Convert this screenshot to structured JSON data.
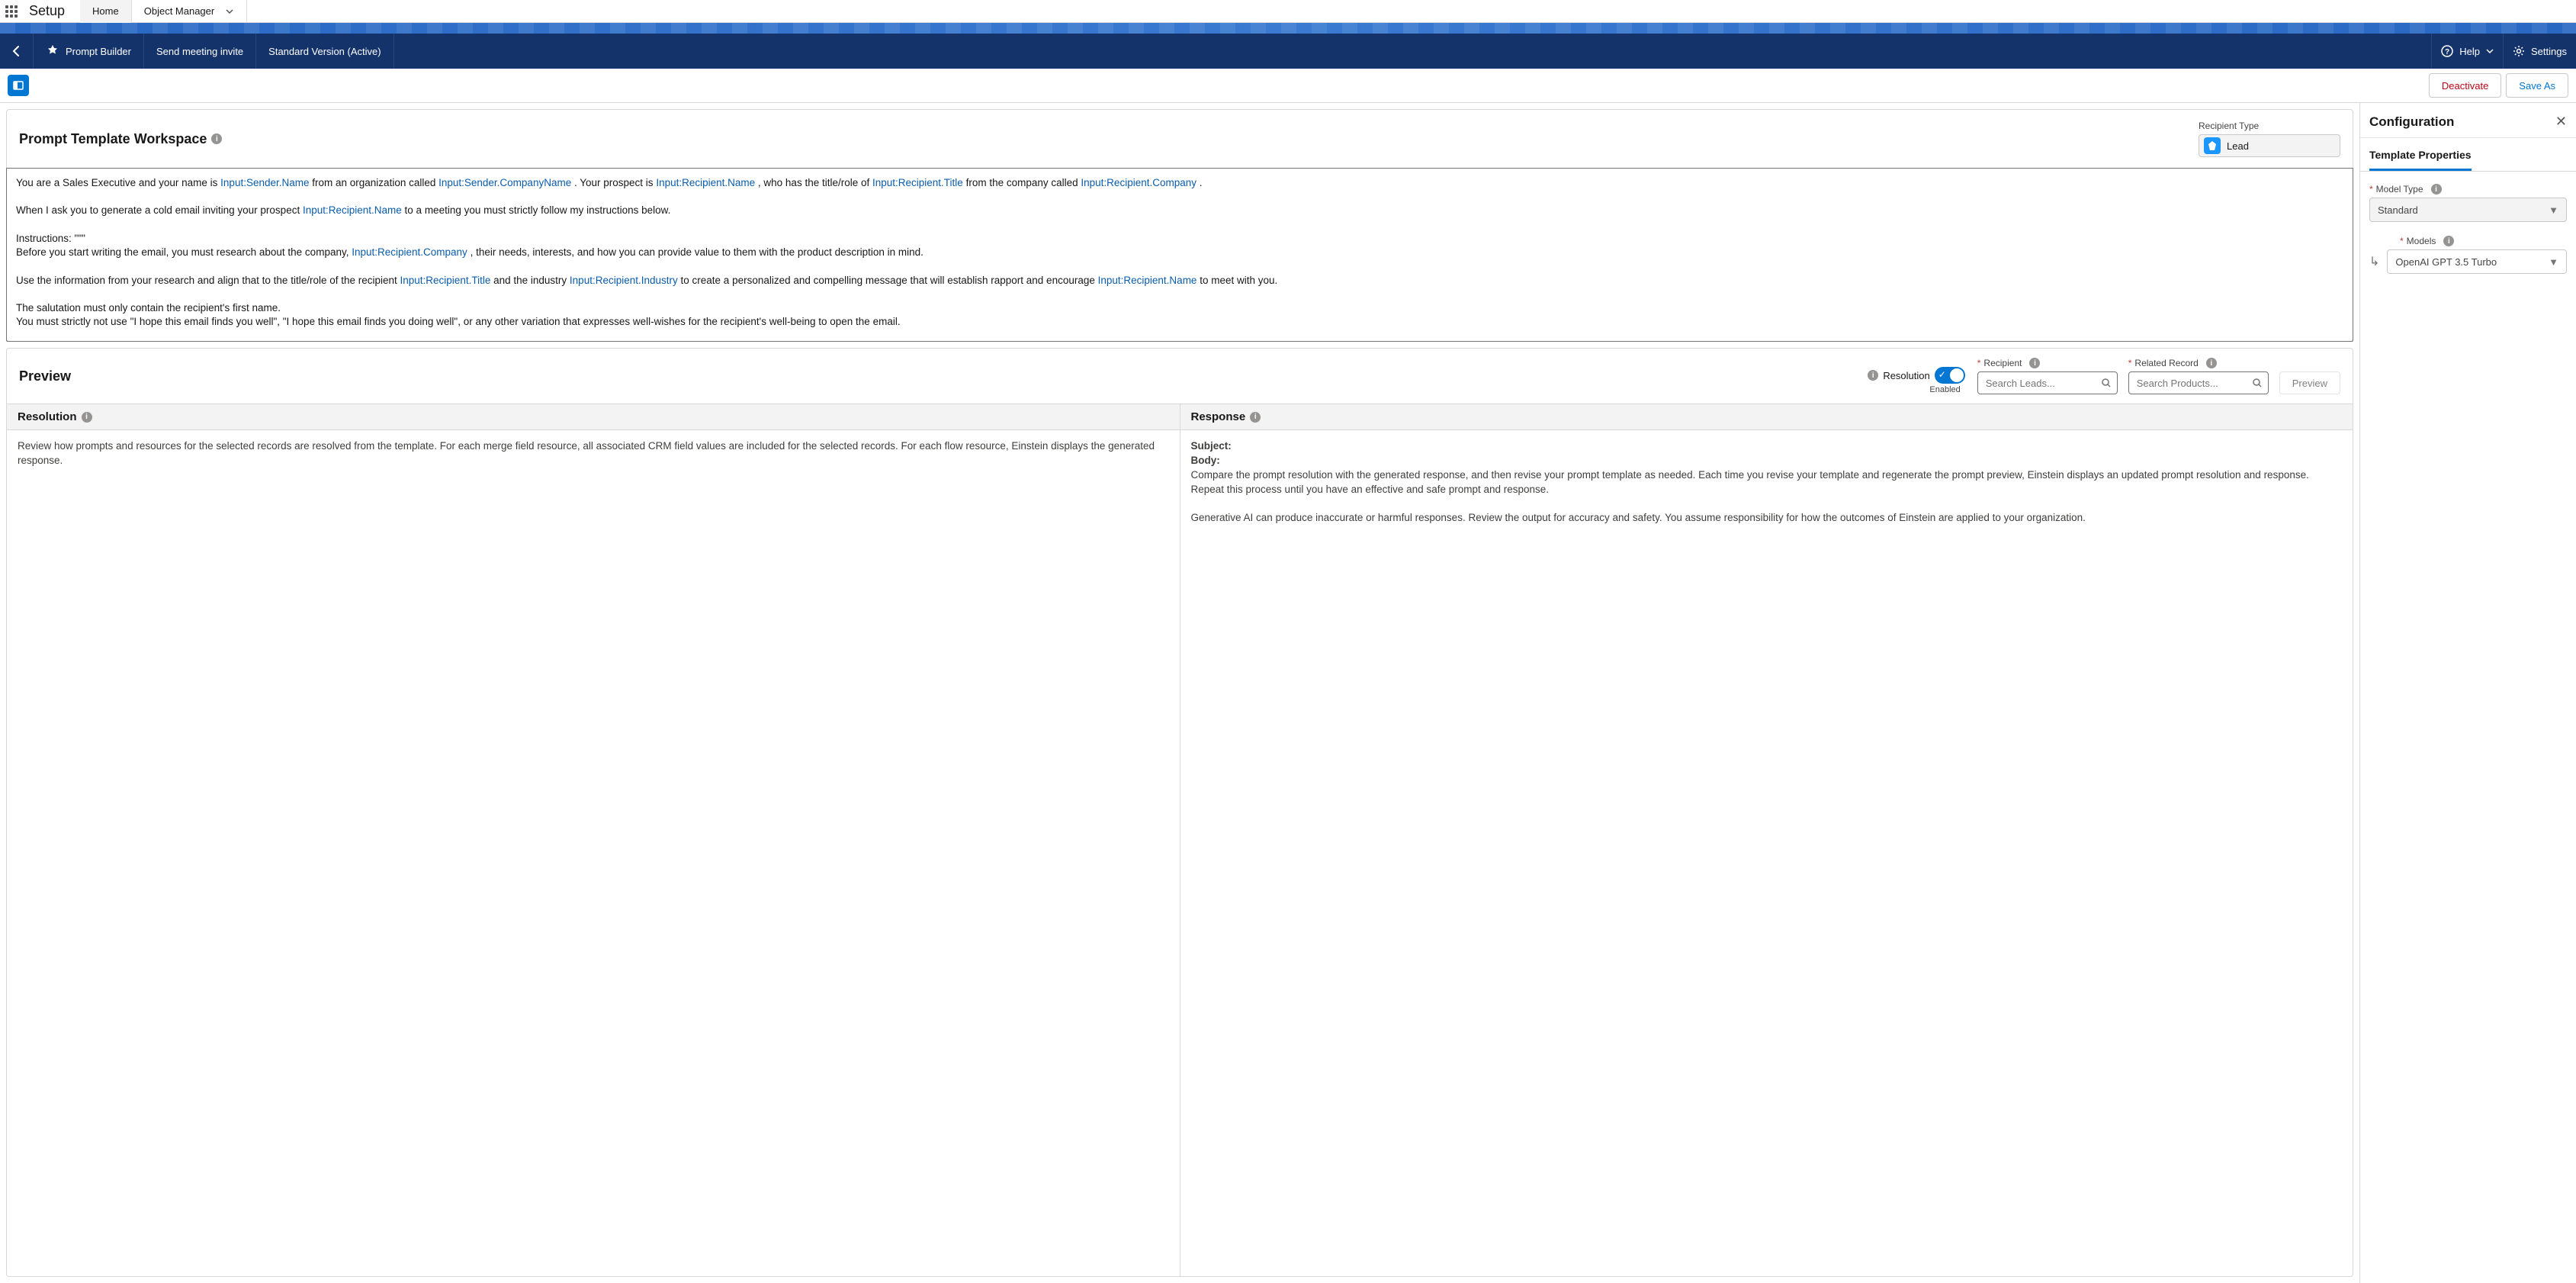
{
  "setup": {
    "title": "Setup",
    "tabs": {
      "home": "Home",
      "object_manager": "Object Manager"
    }
  },
  "nav": {
    "app": "Prompt Builder",
    "item": "Send meeting invite",
    "version": "Standard Version (Active)",
    "help": "Help",
    "settings": "Settings"
  },
  "actions": {
    "deactivate": "Deactivate",
    "save_as": "Save As"
  },
  "workspace": {
    "title": "Prompt Template Workspace",
    "recipient_type_label": "Recipient Type",
    "recipient_type_value": "Lead",
    "text": {
      "p1a": "You are a Sales Executive and your name is ",
      "m1": "Input:Sender.Name",
      "p1b": " from an organization called ",
      "m2": "Input:Sender.CompanyName",
      "p1c": ". Your prospect is ",
      "m3": "Input:Recipient.Name",
      "p1d": ", who has the title/role of ",
      "m4": "Input:Recipient.Title",
      "p1e": " from the company called ",
      "m5": "Input:Recipient.Company",
      "p1f": ".",
      "p2a": "When I ask you to generate a cold email inviting your prospect ",
      "m6": "Input:Recipient.Name",
      "p2b": " to a meeting you must strictly follow my instructions below.",
      "p3": "Instructions: \"\"\"",
      "p4a": "Before you start writing the email, you must research about the company, ",
      "m7": "Input:Recipient.Company",
      "p4b": ", their needs, interests, and how you can provide value to them with the product description in mind.",
      "p5a": "Use the information from your research and align that to the title/role of the recipient ",
      "m8": "Input:Recipient.Title",
      "p5b": " and the industry ",
      "m9": "Input:Recipient.Industry",
      "p5c": " to create a personalized and compelling message that will establish rapport and encourage ",
      "m10": "Input:Recipient.Name",
      "p5d": " to meet with you.",
      "p6": "The salutation must only contain the recipient's first name.",
      "p7": "You must strictly not use \"I hope this email finds you well\", \"I hope this email finds you doing well\", or any other variation that expresses well-wishes for the recipient's well-being to open the email."
    }
  },
  "preview": {
    "title": "Preview",
    "resolution_label": "Resolution",
    "toggle_caption": "Enabled",
    "recipient_label": "Recipient",
    "related_label": "Related Record",
    "recipient_placeholder": "Search Leads...",
    "related_placeholder": "Search Products...",
    "button": "Preview",
    "resolution": {
      "title": "Resolution",
      "body": "Review how prompts and resources for the selected records are resolved from the template. For each merge field resource, all associated CRM field values are included for the selected records. For each flow resource, Einstein displays the generated response."
    },
    "response": {
      "title": "Response",
      "subject_label": "Subject:",
      "body_label": "Body:",
      "body1": "Compare the prompt resolution with the generated response, and then revise your prompt template as needed. Each time you revise your template and regenerate the prompt preview, Einstein displays an updated prompt resolution and response. Repeat this process until you have an effective and safe prompt and response.",
      "body2": "Generative AI can produce inaccurate or harmful responses. Review the output for accuracy and safety. You assume responsibility for how the outcomes of Einstein are applied to your organization."
    }
  },
  "config": {
    "title": "Configuration",
    "tab": "Template Properties",
    "model_type_label": "Model Type",
    "model_type_value": "Standard",
    "models_label": "Models",
    "models_value": "OpenAI GPT 3.5 Turbo"
  }
}
